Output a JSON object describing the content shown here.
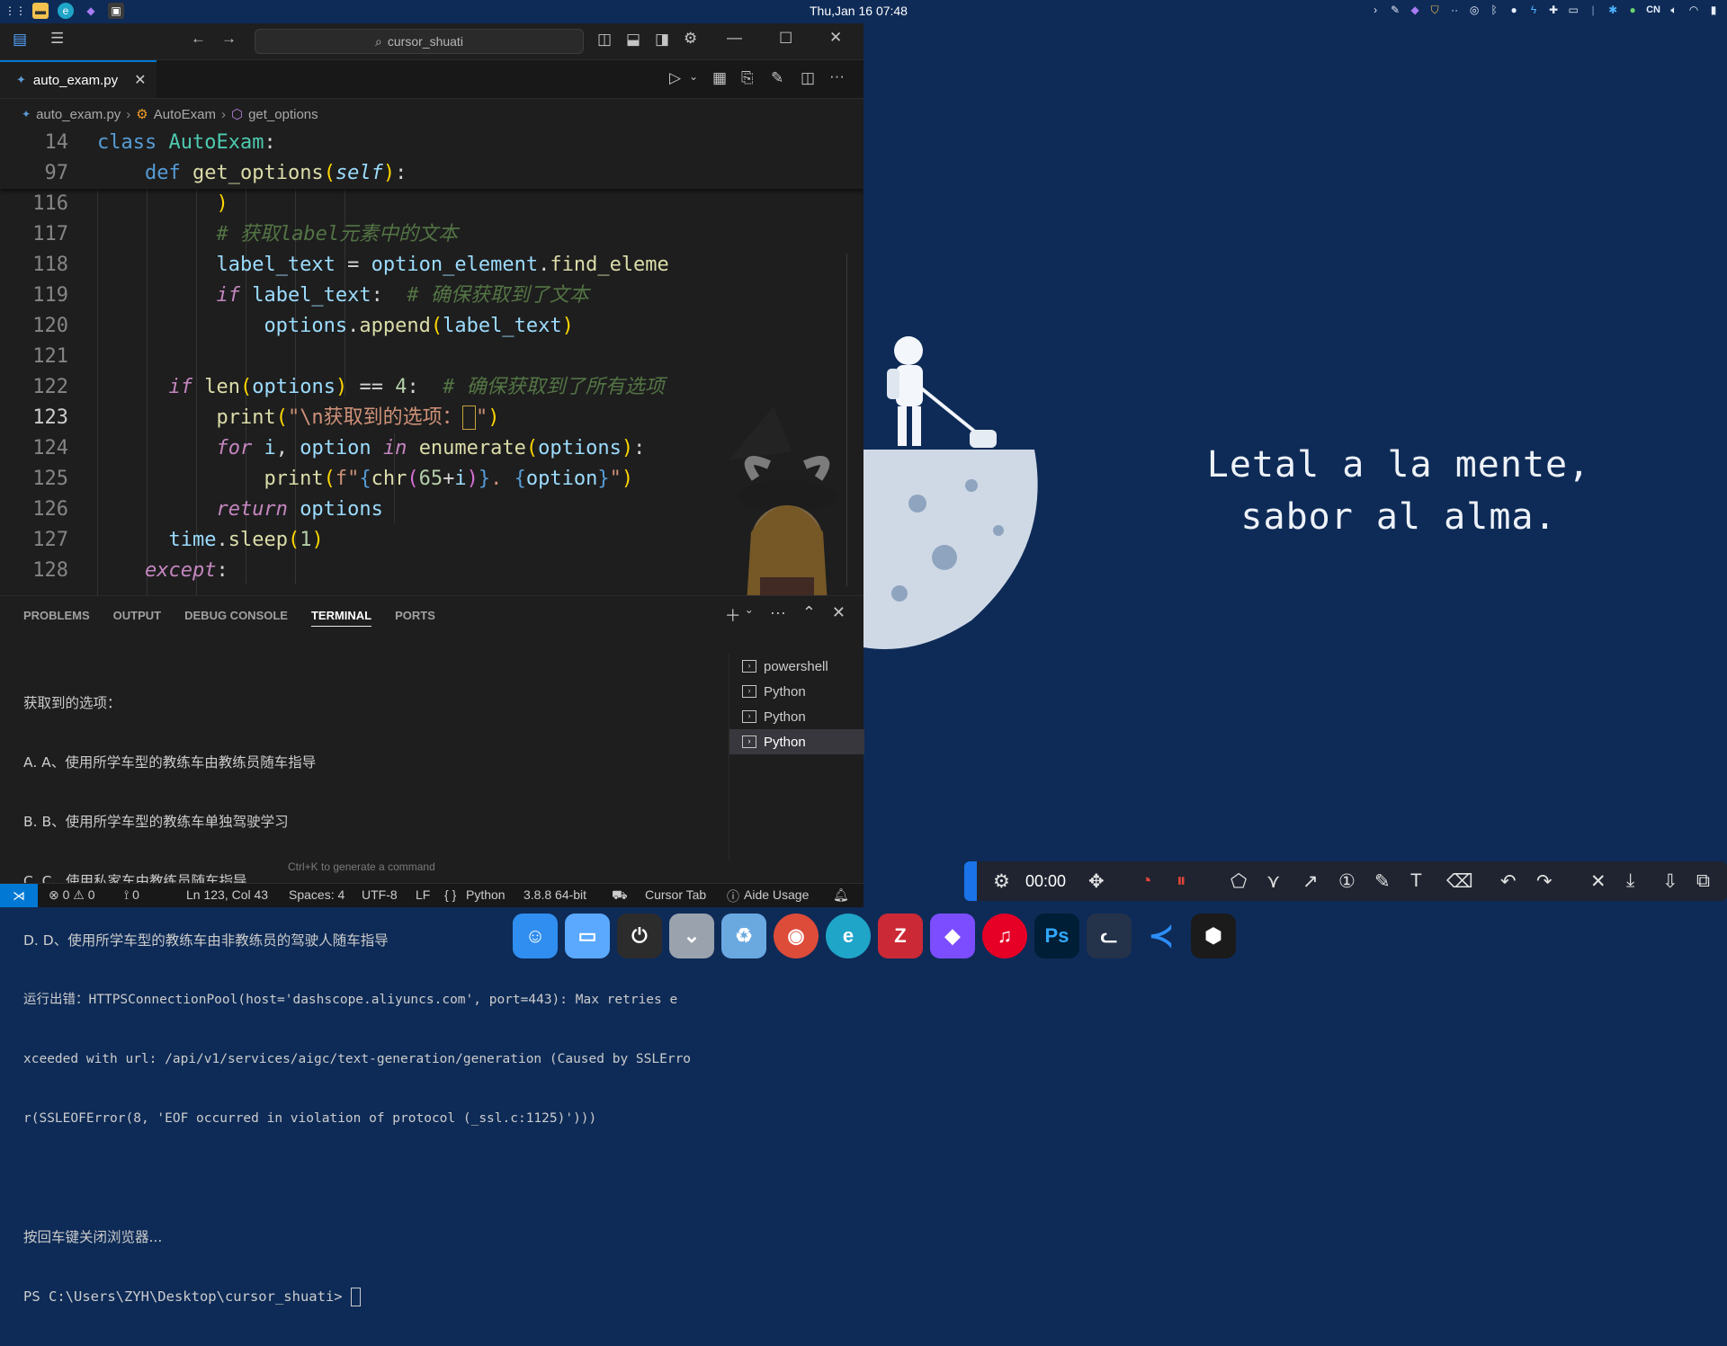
{
  "topbar": {
    "clock": "Thu,Jan 16  07:48",
    "tray_lang": "CN"
  },
  "titlebar": {
    "search_text": "cursor_shuati"
  },
  "tab": {
    "filename": "auto_exam.py"
  },
  "breadcrumb": {
    "file": "auto_exam.py",
    "class": "AutoExam",
    "method": "get_options"
  },
  "code": {
    "line_numbers": [
      "14",
      "97",
      "116",
      "117",
      "118",
      "119",
      "120",
      "121",
      "122",
      "123",
      "124",
      "125",
      "126",
      "127",
      "128"
    ],
    "comment_label": "# 获取label元素中的文本",
    "comment_ensure_text": "# 确保获取到了文本",
    "comment_all_options": "# 确保获取到了所有选项",
    "print_string": "\\n获取到的选项：",
    "expr_label_text": "label_text",
    "expr_option_element": "option_element",
    "expr_find": "find_eleme"
  },
  "panel": {
    "tabs": [
      "PROBLEMS",
      "OUTPUT",
      "DEBUG CONSOLE",
      "TERMINAL",
      "PORTS"
    ],
    "active_tab": "TERMINAL",
    "terminal_lines": [
      "获取到的选项：",
      "A. A、使用所学车型的教练车由教练员随车指导",
      "B. B、使用所学车型的教练车单独驾驶学习",
      "C. C、使用私家车由教练员随车指导",
      "D. D、使用所学车型的教练车由非教练员的驾驶人随车指导",
      "运行出错：HTTPSConnectionPool(host='dashscope.aliyuncs.com', port=443): Max retries e",
      "xceeded with url: /api/v1/services/aigc/text-generation/generation (Caused by SSLErro",
      "r(SSLEOFError(8, 'EOF occurred in violation of protocol (_ssl.c:1125)')))",
      "",
      "按回车键关闭浏览器...",
      "PS C:\\Users\\ZYH\\Desktop\\cursor_shuati> "
    ],
    "terminal_instances": [
      "powershell",
      "Python",
      "Python",
      "Python"
    ],
    "hint": "Ctrl+K to generate a command"
  },
  "status": {
    "errors": "0",
    "warnings": "0",
    "ports": "0",
    "position": "Ln 123, Col 43",
    "spaces": "Spaces: 4",
    "encoding": "UTF-8",
    "eol": "LF",
    "language": "Python",
    "interpreter": "3.8.8 64-bit",
    "cursor_tab": "Cursor Tab",
    "aide_usage": "Aide Usage"
  },
  "wallpaper": {
    "quote_line1": "Letal a la mente,",
    "quote_line2": "sabor al alma."
  },
  "annotation_toolbar": {
    "timer": "00:00"
  },
  "dock": {
    "apps": [
      "finder",
      "files",
      "power",
      "downloads",
      "recycle",
      "chrome",
      "edge",
      "zotero",
      "obsidian",
      "netease-music",
      "photoshop",
      "cat-app",
      "vscode",
      "cursor"
    ]
  }
}
